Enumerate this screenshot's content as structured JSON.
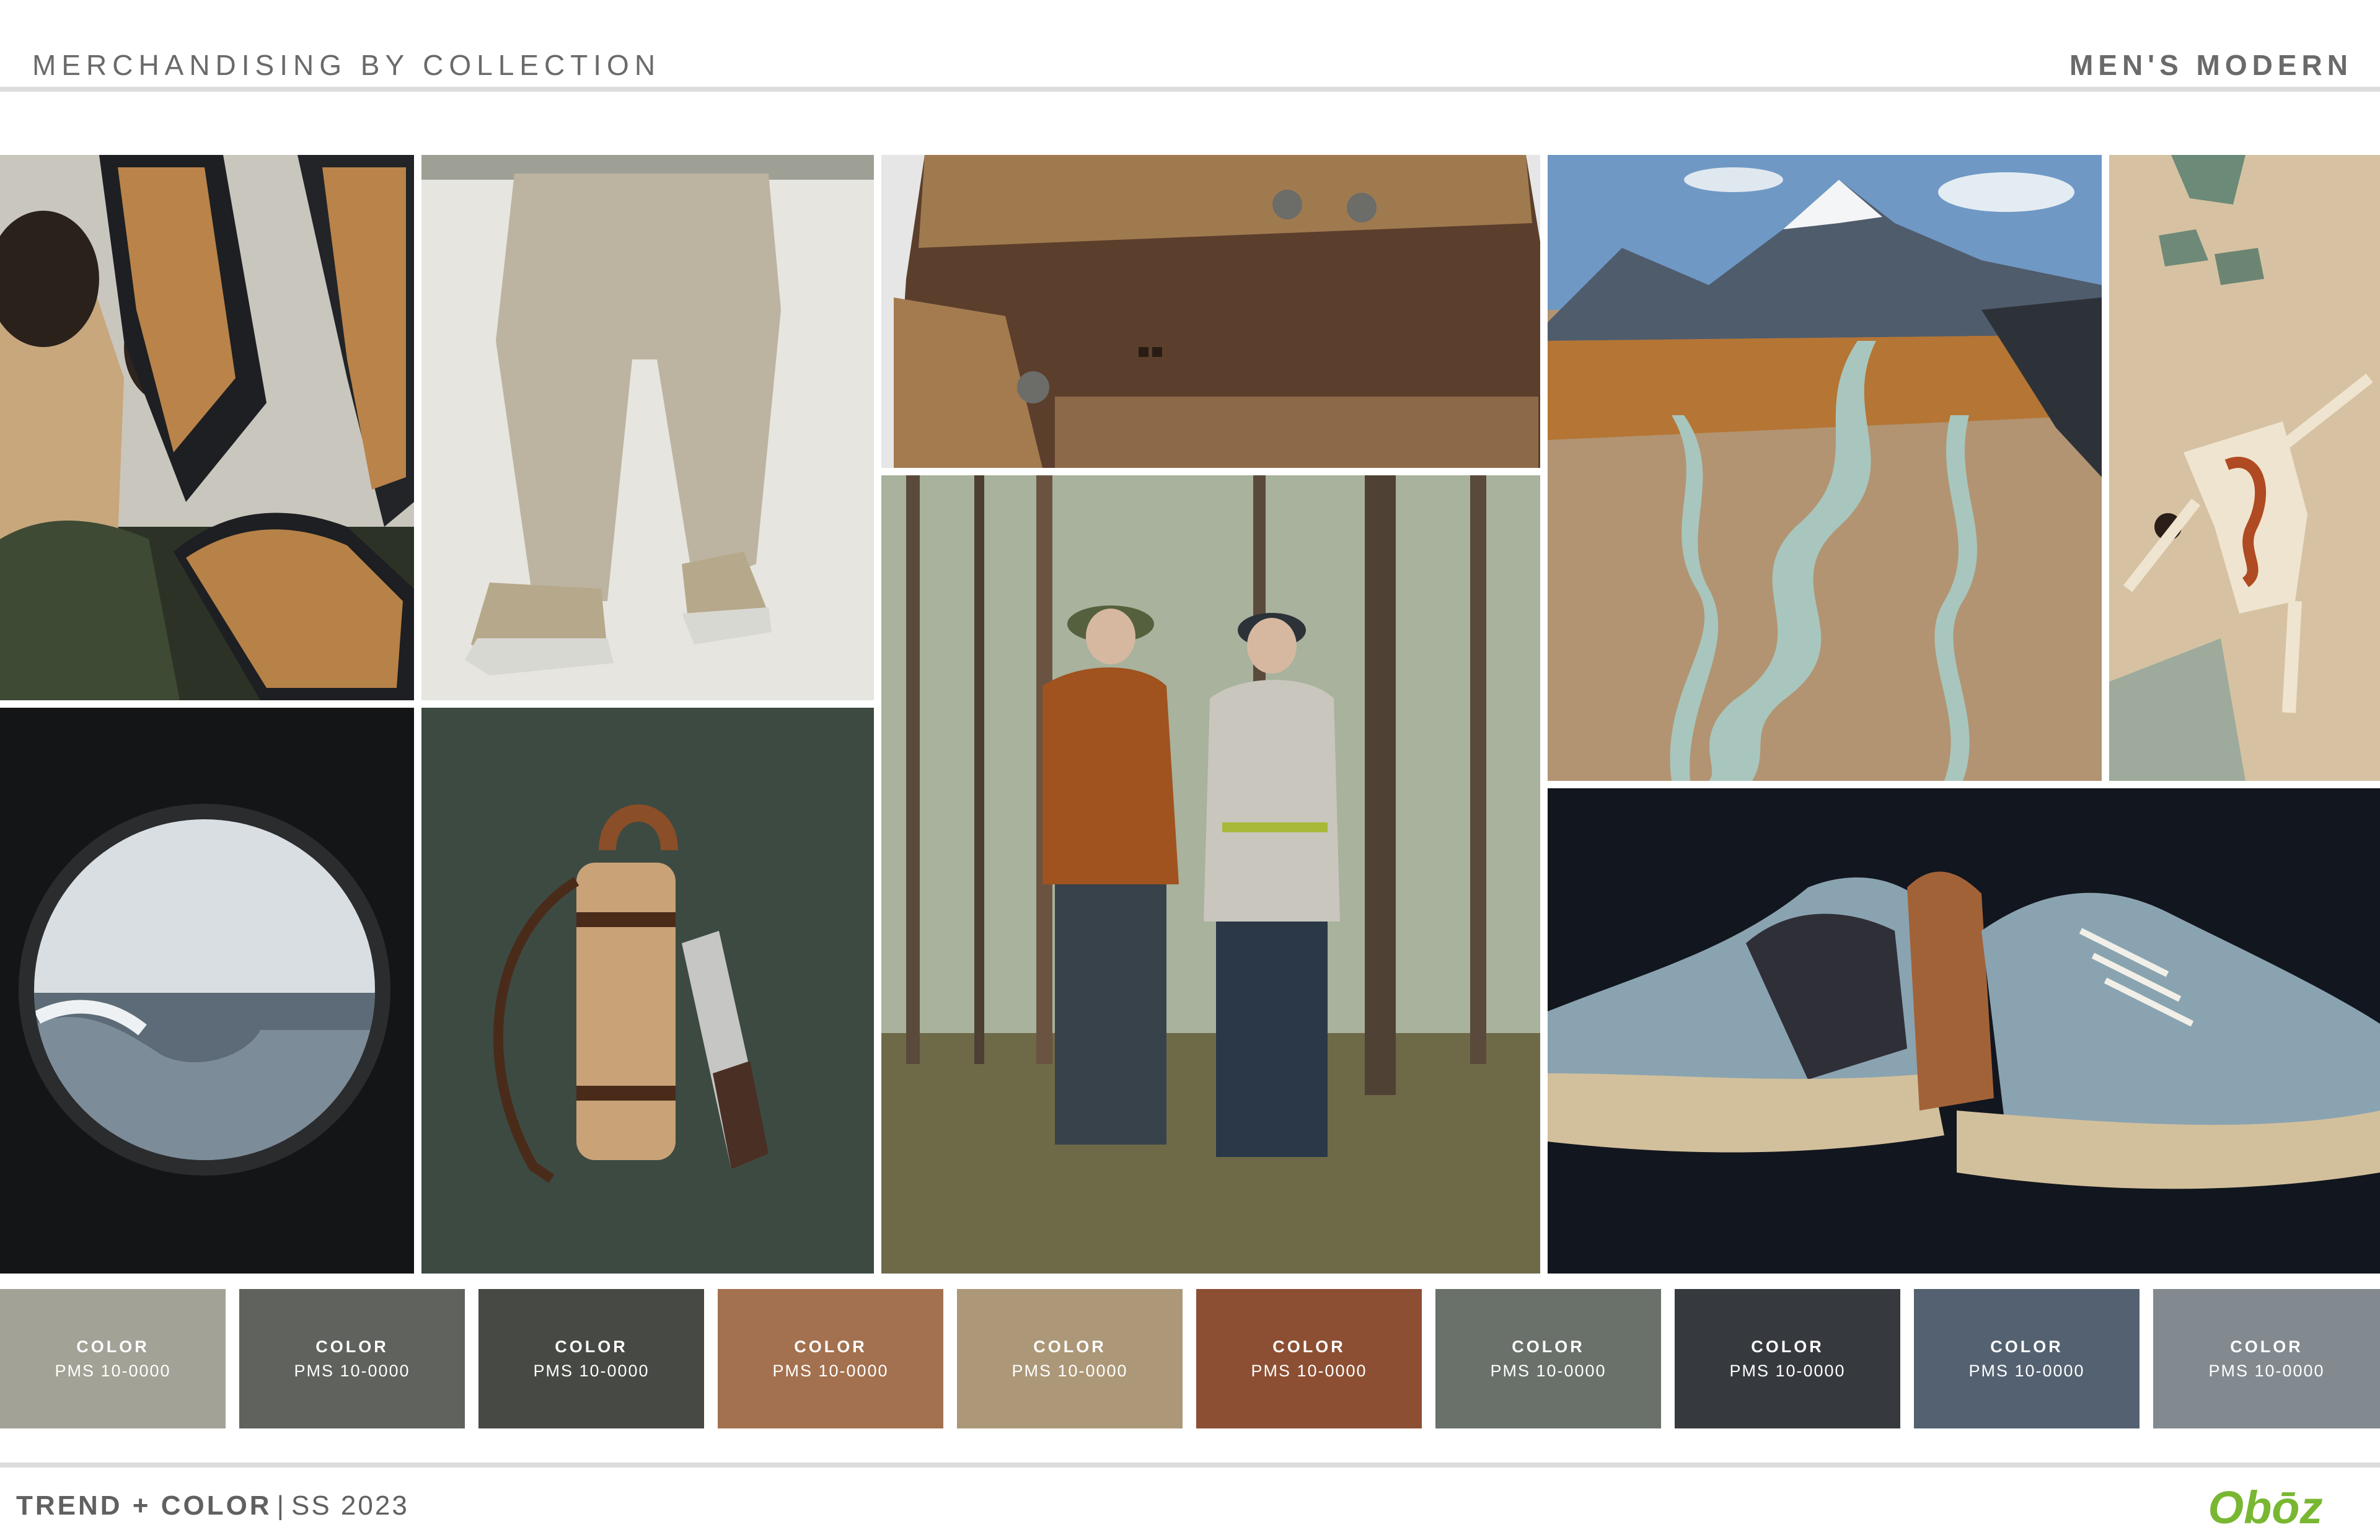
{
  "header": {
    "title": "MERCHANDISING BY COLLECTION",
    "collection": "MEN'S MODERN"
  },
  "photos": [
    {
      "name": "cane-chair-people-photo"
    },
    {
      "name": "khaki-pants-sneakers-photo"
    },
    {
      "name": "canvas-jacket-detail-photo"
    },
    {
      "name": "braided-river-mountain-photo"
    },
    {
      "name": "figure-in-sand-photo"
    },
    {
      "name": "porthole-ocean-photo"
    },
    {
      "name": "leather-bottle-carrier-photo"
    },
    {
      "name": "hikers-in-forest-photo"
    },
    {
      "name": "blue-tan-sneakers-photo"
    }
  ],
  "palette": [
    {
      "name": "COLOR",
      "pms": "PMS 10-0000",
      "color": "#a3a296"
    },
    {
      "name": "COLOR",
      "pms": "PMS 10-0000",
      "color": "#5f625d"
    },
    {
      "name": "COLOR",
      "pms": "PMS 10-0000",
      "color": "#474a44"
    },
    {
      "name": "COLOR",
      "pms": "PMS 10-0000",
      "color": "#a3714f"
    },
    {
      "name": "COLOR",
      "pms": "PMS 10-0000",
      "color": "#ac9878"
    },
    {
      "name": "COLOR",
      "pms": "PMS 10-0000",
      "color": "#8c4f33"
    },
    {
      "name": "COLOR",
      "pms": "PMS 10-0000",
      "color": "#69716a"
    },
    {
      "name": "COLOR",
      "pms": "PMS 10-0000",
      "color": "#363a3e"
    },
    {
      "name": "COLOR",
      "pms": "PMS 10-0000",
      "color": "#536170"
    },
    {
      "name": "COLOR",
      "pms": "PMS 10-0000",
      "color": "#828a90"
    }
  ],
  "footer": {
    "label": "TREND + COLOR",
    "separator": "|",
    "season": "SS 2023",
    "brand": "Obōz",
    "brand_color": "#79b732"
  }
}
